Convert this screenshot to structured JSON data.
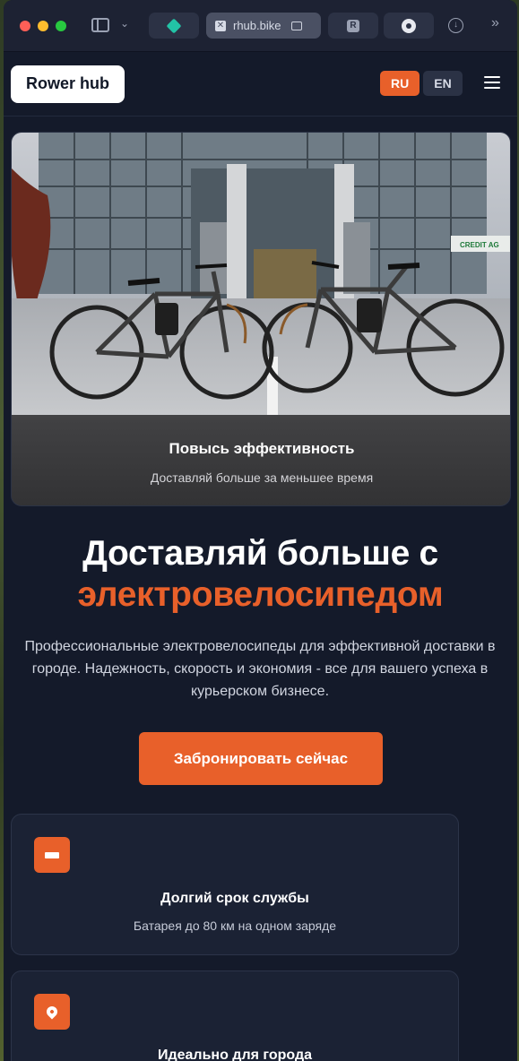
{
  "browser": {
    "active_tab_label": "rhub.bike",
    "tab_r_letter": "R"
  },
  "site": {
    "logo": "Rower hub",
    "lang_ru": "RU",
    "lang_en": "EN"
  },
  "hero": {
    "caption_title": "Повысь эффективность",
    "caption_subtitle": "Доставляй больше за меньшее время",
    "storefront_sign": "CREDIT AG"
  },
  "headline": {
    "line1": "Доставляй больше с",
    "line2": "электровелосипедом"
  },
  "lead": "Профессиональные электровелосипеды для эффективной доставки в городе. Надежность, скорость и экономия - все для вашего успеха в курьерском бизнесе.",
  "cta_label": "Забронировать сейчас",
  "features": [
    {
      "icon": "battery-icon",
      "title": "Долгий срок службы",
      "description": "Батарея до 80 км на одном заряде"
    },
    {
      "icon": "map-pin-icon",
      "title": "Идеально для города",
      "description": ""
    }
  ],
  "colors": {
    "accent": "#e8602a",
    "page_bg": "#141a2a",
    "card_bg": "#1b2234"
  }
}
